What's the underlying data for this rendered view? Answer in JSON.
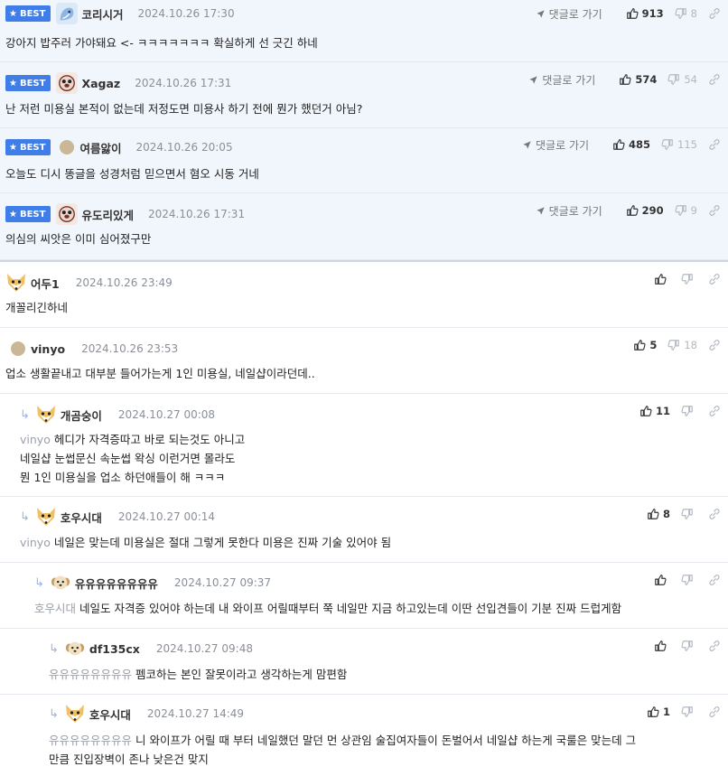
{
  "labels": {
    "best": "BEST",
    "reply_link": "댓글로 가기"
  },
  "colors": {
    "badge": "#3f7de8",
    "best_bg": "#f1f5fc",
    "reply_arrow": "#9bb4e8"
  },
  "comments": [
    {
      "nick": "코리시거",
      "date": "2024.10.26 17:30",
      "up": "913",
      "down": "8",
      "text": "강아지 밥주러 가야돼요 <- ㅋㅋㅋㅋㅋㅋㅋ 확실하게 선 긋긴 하네"
    },
    {
      "nick": "Xagaz",
      "date": "2024.10.26 17:31",
      "up": "574",
      "down": "54",
      "text": "난 저런 미용실 본적이 없는데 저정도면 미용사 하기 전에 뭔가 했던거 아님?"
    },
    {
      "nick": "여름앓이",
      "date": "2024.10.26 20:05",
      "up": "485",
      "down": "115",
      "text": "오늘도 디시 똥글을 성경처럼 믿으면서 혐오 시동 거네"
    },
    {
      "nick": "유도리있게",
      "date": "2024.10.26 17:31",
      "up": "290",
      "down": "9",
      "text": "의심의 씨앗은 이미 심어졌구만"
    },
    {
      "nick": "어두1",
      "date": "2024.10.26 23:49",
      "up": "",
      "down": "",
      "text": "개꼴리긴하네"
    },
    {
      "nick": "vinyo",
      "date": "2024.10.26 23:53",
      "up": "5",
      "down": "18",
      "text": "업소 생활끝내고 대부분 들어가는게 1인 미용실, 네일샵이라던데.."
    },
    {
      "nick": "개곰숭이",
      "date": "2024.10.27 00:08",
      "up": "11",
      "down": "",
      "mention": "vinyo",
      "text": "헤디가 자격증따고 바로 되는것도 아니고\n네일샵 눈썹문신 속눈썹 왁싱 이런거면 몰라도\n뭔 1인 미용실을 업소 하던애들이 해 ㅋㅋㅋ"
    },
    {
      "nick": "호우시대",
      "date": "2024.10.27 00:14",
      "up": "8",
      "down": "",
      "mention": "vinyo",
      "text": "네일은 맞는데 미용실은 절대 그렇게 못한다 미용은 진짜 기술 있어야 됨"
    },
    {
      "nick": "유유유유유유유유",
      "date": "2024.10.27 09:37",
      "up": "",
      "down": "",
      "mention": "호우시대",
      "text": "네일도 자격증 있어야 하는데 내 와이프 어릴때부터 쭉 네일만 지금 하고있는데 이딴 선입견들이 기분 진짜 드럽게함"
    },
    {
      "nick": "df135cx",
      "date": "2024.10.27 09:48",
      "up": "",
      "down": "",
      "mention": "유유유유유유유유",
      "text": "펨코하는 본인 잘못이라고 생각하는게 맘편함"
    },
    {
      "nick": "호우시대",
      "date": "2024.10.27 14:49",
      "up": "1",
      "down": "",
      "mention": "유유유유유유유유",
      "text": "니 와이프가 어릴 때 부터 네일했던 말던 먼 상관임 술집여자들이 돈벌어서 네일샵 하는게 국룰은 맞는데 그\n만큼 진입장벽이 존나 낮은건 맞지"
    }
  ]
}
